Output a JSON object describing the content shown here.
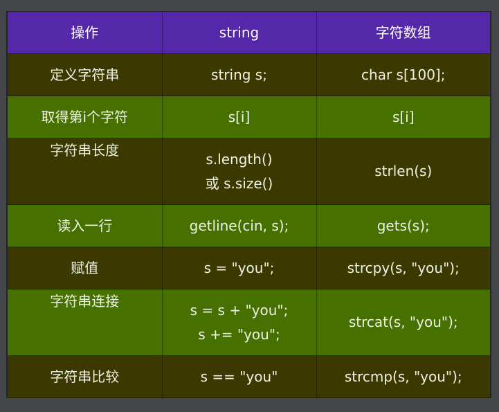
{
  "table": {
    "headers": [
      "操作",
      "string",
      "字符数组"
    ],
    "rows": [
      {
        "op": "定义字符串",
        "string": [
          "string s;"
        ],
        "chararray": "char s[100];"
      },
      {
        "op": "取得第i个字符",
        "string": [
          "s[i]"
        ],
        "chararray": "s[i]"
      },
      {
        "op": "字符串长度",
        "string": [
          "s.length()",
          "或 s.size()"
        ],
        "chararray": "strlen(s)"
      },
      {
        "op": "读入一行",
        "string": [
          "getline(cin, s);"
        ],
        "chararray": "gets(s);"
      },
      {
        "op": "赋值",
        "string": [
          "s = \"you\";"
        ],
        "chararray": "strcpy(s, \"you\");"
      },
      {
        "op": "字符串连接",
        "string": [
          "s = s + \"you\";",
          "s += \"you\";"
        ],
        "chararray": "strcat(s, \"you\");"
      },
      {
        "op": "字符串比较",
        "string": [
          "s == \"you\""
        ],
        "chararray": "strcmp(s, \"you\");"
      }
    ]
  },
  "colors": {
    "page_background": "#45464a",
    "header_background": "#5428a8",
    "row_dark": "#3b3800",
    "row_green": "#467000",
    "text": "#eef2e4"
  }
}
